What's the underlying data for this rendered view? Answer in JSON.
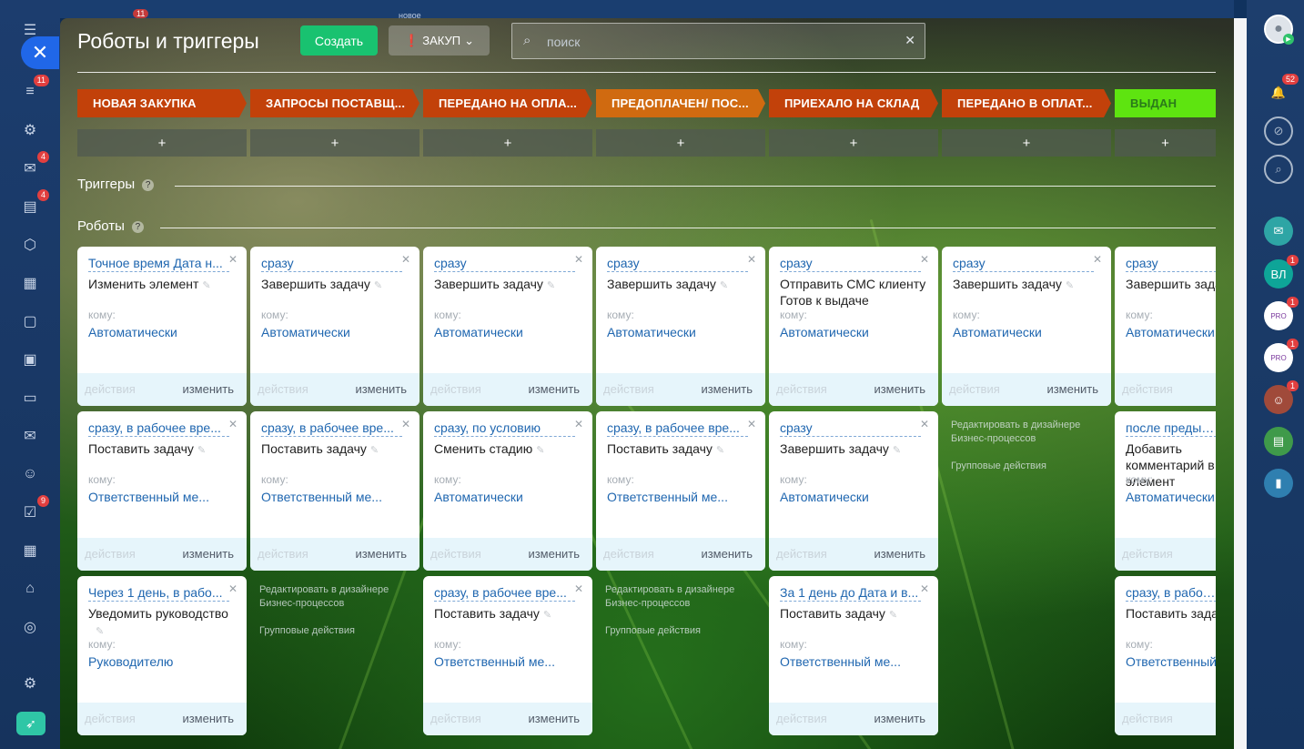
{
  "topbar": {
    "badge": "11",
    "ghost_text": "новое"
  },
  "leftbar": {
    "badges": {
      "feed": "11",
      "chat": "4",
      "tasks": "4",
      "checklist": "9"
    }
  },
  "header": {
    "title": "Роботы и триггеры",
    "create_label": "Создать",
    "category_label": "ЗАКУП",
    "search_placeholder": "поиск"
  },
  "stages": [
    {
      "label": "НОВАЯ ЗАКУПКА",
      "color": "#c2410a"
    },
    {
      "label": "ЗАПРОСЫ ПОСТАВЩ...",
      "color": "#c2410a"
    },
    {
      "label": "ПЕРЕДАНО НА ОПЛА...",
      "color": "#c2410a"
    },
    {
      "label": "ПРЕДОПЛАЧЕН/ ПОС...",
      "color": "#d06a10"
    },
    {
      "label": "ПРИЕХАЛО НА СКЛАД",
      "color": "#c2410a"
    },
    {
      "label": "ПЕРЕДАНО В ОПЛАТ...",
      "color": "#c2410a"
    },
    {
      "label": "ВЫДАН",
      "color": "#5ee410"
    }
  ],
  "sections": {
    "triggers": "Триггеры",
    "robots": "Роботы"
  },
  "common": {
    "whom": "кому:",
    "actions": "действия",
    "edit": "изменить",
    "add": "+",
    "designer_link": "Редактировать в дизайнере Бизнес-процессов",
    "group_actions": "Групповые действия"
  },
  "robots": {
    "row1": [
      {
        "cond": "Точное время Дата н...",
        "name": "Изменить элемент",
        "resp": "Автоматически"
      },
      {
        "cond": "сразу",
        "name": "Завершить задачу",
        "resp": "Автоматически"
      },
      {
        "cond": "сразу",
        "name": "Завершить задачу",
        "resp": "Автоматически"
      },
      {
        "cond": "сразу",
        "name": "Завершить задачу",
        "resp": "Автоматически"
      },
      {
        "cond": "сразу",
        "name": "Отправить СМС клиенту Готов к выдаче",
        "resp": "Автоматически"
      },
      {
        "cond": "сразу",
        "name": "Завершить задачу",
        "resp": "Автоматически"
      },
      {
        "cond": "сразу",
        "name": "Завершить задачу",
        "resp": "Автоматически"
      }
    ],
    "row2": [
      {
        "cond": "сразу, в рабочее вре...",
        "name": "Поставить задачу",
        "resp": "Ответственный ме..."
      },
      {
        "cond": "сразу, в рабочее вре...",
        "name": "Поставить задачу",
        "resp": "Ответственный ме..."
      },
      {
        "cond": "сразу, по условию",
        "name": "Сменить стадию",
        "resp": "Автоматически"
      },
      {
        "cond": "сразу, в рабочее вре...",
        "name": "Поставить задачу",
        "resp": "Ответственный ме..."
      },
      {
        "cond": "сразу",
        "name": "Завершить задачу",
        "resp": "Автоматически"
      },
      {
        "cond": "после предыдущего",
        "name": "Добавить комментарий в элемент",
        "resp": "Автоматически"
      }
    ],
    "row3": [
      {
        "cond": "Через 1 день, в рабо...",
        "name": "Уведомить руководство",
        "resp": "Руководителю"
      },
      {
        "cond": "сразу, в рабочее вре...",
        "name": "Поставить задачу",
        "resp": "Ответственный ме..."
      },
      {
        "cond": "За 1 день до Дата и в...",
        "name": "Поставить задачу",
        "resp": "Ответственный ме..."
      },
      {
        "cond": "сразу, в рабочее вре...",
        "name": "Поставить задачу",
        "resp": "Ответственный ме..."
      }
    ]
  },
  "rightbar": {
    "notifications_badge": "52",
    "avatar_vl": "ВЛ",
    "badge_one": "1"
  }
}
